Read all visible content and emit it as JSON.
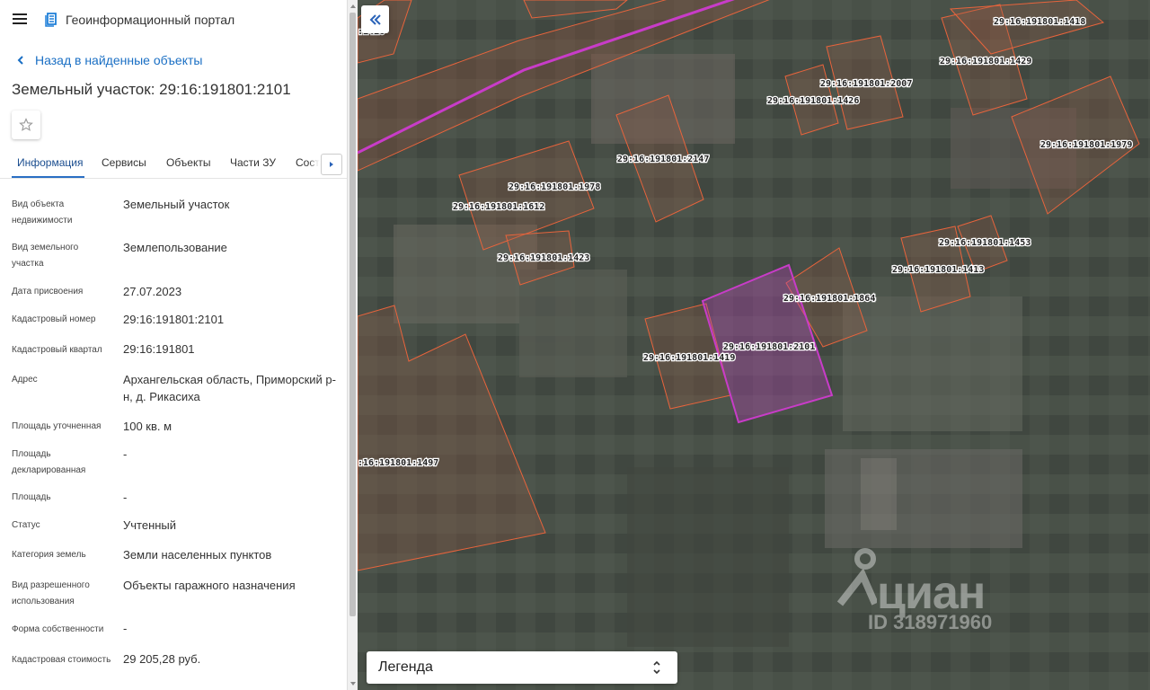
{
  "app": {
    "title": "Геоинформационный портал",
    "logo_icon": "layers-icon",
    "menu_icon": "hamburger-menu-icon"
  },
  "nav": {
    "back_label": "Назад в найденные объекты"
  },
  "object": {
    "title": "Земельный участок: 29:16:191801:2101"
  },
  "tabs": [
    {
      "label": "Информация",
      "active": true
    },
    {
      "label": "Сервисы"
    },
    {
      "label": "Объекты"
    },
    {
      "label": "Части ЗУ"
    },
    {
      "label": "Соста"
    }
  ],
  "info": [
    {
      "label": "Вид объекта недвижимости",
      "value": "Земельный участок"
    },
    {
      "label": "Вид земельного участка",
      "value": "Землепользование"
    },
    {
      "label": "Дата присвоения",
      "value": "27.07.2023"
    },
    {
      "label": "Кадастровый номер",
      "value": "29:16:191801:2101"
    },
    {
      "label": "Кадастровый квартал",
      "value": "29:16:191801"
    },
    {
      "label": "Адрес",
      "value": "Архангельская область, Приморский р-н, д. Рикасиха"
    },
    {
      "label": "Площадь уточненная",
      "value": "100 кв. м"
    },
    {
      "label": "Площадь декларированная",
      "value": "-"
    },
    {
      "label": "Площадь",
      "value": "-"
    },
    {
      "label": "Статус",
      "value": "Учтенный"
    },
    {
      "label": "Категория земель",
      "value": "Земли населенных пунктов"
    },
    {
      "label": "Вид разрешенного использования",
      "value": "Объекты гаражного назначения"
    },
    {
      "label": "Форма собственности",
      "value": "-"
    },
    {
      "label": "Кадастровая стоимость",
      "value": "29 205,28 руб."
    }
  ],
  "map": {
    "collapse_icon": "double-chevron-left-icon",
    "parcel_color": "#e8643c",
    "selected_color": "#c83cc8",
    "labels": [
      "29:16:191801:1418",
      "29:16:191801:1429",
      "29:16:191801:2007",
      "29:16:191801:1426",
      "29:16:191801:1979",
      "29:16:191801:2147",
      "29:16:191801:1978",
      "29:16:191801:1612",
      "29:16:191801:1423",
      "29:16:191801:1453",
      "29:16:191801:1413",
      "29:16:191801:1864",
      "29:16:191801:2101",
      "29:16:191801:1419",
      ":16:191801:1497",
      ":1416"
    ]
  },
  "legend": {
    "label": "Легенда"
  },
  "watermark": {
    "brand": "циан",
    "id": "ID 318971960"
  }
}
